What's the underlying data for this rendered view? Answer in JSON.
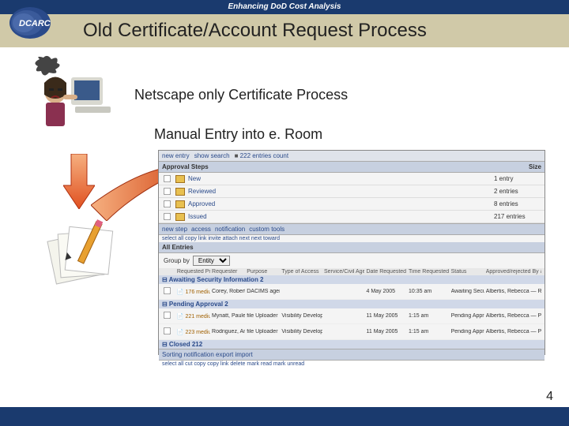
{
  "header_tag": "Enhancing DoD Cost Analysis",
  "logo_text": "DCARC",
  "title": "Old Certificate/Account Request Process",
  "subtitle1": "Netscape only Certificate Process",
  "subtitle2": "Manual Entry into e. Room",
  "page_number": "4",
  "eroom": {
    "top_links": [
      "new entry",
      "show search"
    ],
    "top_count": "222 entries count",
    "approval_header": "Approval Steps",
    "size_header": "Size",
    "folders": [
      {
        "name": "New",
        "size": "1 entry"
      },
      {
        "name": "Reviewed",
        "size": "2 entries"
      },
      {
        "name": "Approved",
        "size": "8 entries"
      },
      {
        "name": "Issued",
        "size": "217 entries"
      }
    ],
    "mid_tabs": [
      "new step",
      "access",
      "notification",
      "custom tools"
    ],
    "mid_actions": "select all   copy link   invite   attach next   next toward",
    "all_entries": "All Entries",
    "group_label": "Group by",
    "group_value": "Entity",
    "columns": [
      "",
      "Requested Priority",
      "Requester",
      "Purpose",
      "Type of Access",
      "Service/Civil Agency",
      "Date Requested",
      "Time Requested",
      "Status",
      "Approved/rejected By & process Step"
    ],
    "groups": [
      {
        "header": "Awaiting Security Information 2",
        "rows": [
          {
            "id": "176",
            "priority": "medium Priority",
            "requester": "Corey, Robert",
            "purpose": "DACIMS agency Analyst",
            "type": "",
            "service": "",
            "date": "4 May 2005",
            "time": "10:35 am",
            "status": "Awaiting Security Info",
            "approved": "Albertis, Rebecca — Rosa"
          }
        ]
      },
      {
        "header": "Pending Approval 2",
        "rows": [
          {
            "id": "221",
            "priority": "medium Priority",
            "requester": "Mynatt, Paulette",
            "purpose": "file Uploader",
            "type": "Visibility Developer",
            "service": "",
            "date": "11 May 2005",
            "time": "1:15 am",
            "status": "Pending Approval",
            "approved": "Albertis, Rebecca — Pending Approval"
          },
          {
            "id": "223",
            "priority": "medium Priority",
            "requester": "Rodriguez, Amy",
            "purpose": "file Uploader",
            "type": "Visibility Developer",
            "service": "",
            "date": "11 May 2005",
            "time": "1:15 am",
            "status": "Pending Approval",
            "approved": "Albertis, Rebecca — Pending Approval"
          }
        ]
      },
      {
        "header": "Closed 212",
        "rows": []
      }
    ],
    "bottom_tabs": "Sorting   notification   export   import",
    "bottom_actions": "select all   cut   copy   copy link   delete   mark read   mark unread"
  }
}
